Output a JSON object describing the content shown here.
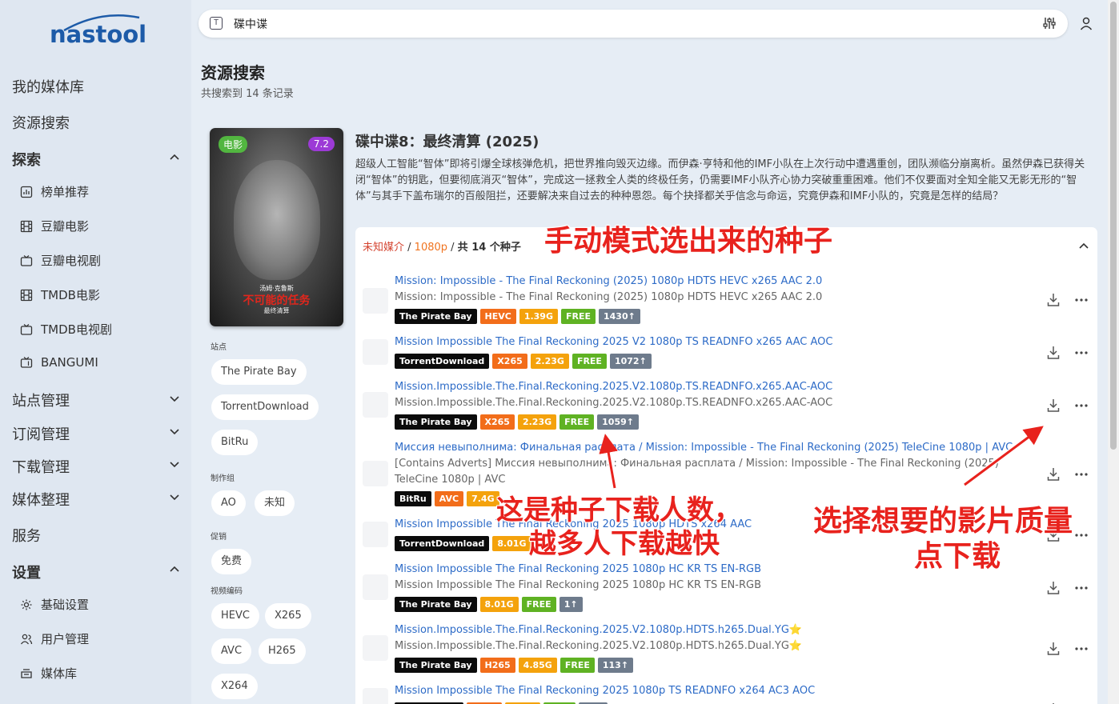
{
  "app": {
    "logo": "nastool"
  },
  "sidebar": {
    "items": [
      {
        "label": "我的媒体库"
      },
      {
        "label": "资源搜索"
      },
      {
        "label": "探索"
      },
      {
        "label": "站点管理"
      },
      {
        "label": "订阅管理"
      },
      {
        "label": "下载管理"
      },
      {
        "label": "媒体整理"
      },
      {
        "label": "服务"
      },
      {
        "label": "设置"
      }
    ],
    "explore_sub": [
      {
        "label": "榜单推荐",
        "icon": "chart-icon"
      },
      {
        "label": "豆瓣电影",
        "icon": "film-icon"
      },
      {
        "label": "豆瓣电视剧",
        "icon": "tv-icon"
      },
      {
        "label": "TMDB电影",
        "icon": "film-icon"
      },
      {
        "label": "TMDB电视剧",
        "icon": "tv-icon"
      },
      {
        "label": "BANGUMI",
        "icon": "tv-icon"
      }
    ],
    "settings_sub": [
      {
        "label": "基础设置",
        "icon": "gear-icon"
      },
      {
        "label": "用户管理",
        "icon": "users-icon"
      },
      {
        "label": "媒体库",
        "icon": "library-icon"
      }
    ]
  },
  "search": {
    "value": "碟中谍"
  },
  "header": {
    "title": "资源搜索",
    "subtitle": "共搜索到 14 条记录"
  },
  "poster": {
    "tag": "电影",
    "rating": "7.2",
    "cap1": "汤姆·克鲁斯",
    "cap2": "不可能的任务",
    "cap3": "最终清算"
  },
  "filters": {
    "site_label": "站点",
    "sites": [
      "The Pirate Bay",
      "TorrentDownload",
      "BitRu"
    ],
    "group_label": "制作组",
    "groups": [
      "AO",
      "未知"
    ],
    "promo_label": "促销",
    "promos": [
      "免费"
    ],
    "codec_label": "视频编码",
    "codecs": [
      "HEVC",
      "X265",
      "AVC",
      "H265",
      "X264"
    ]
  },
  "movie": {
    "title": "碟中谍8：最终清算 (2025)",
    "description": "超级人工智能“智体”即将引爆全球核弹危机，把世界推向毁灭边缘。而伊森·亨特和他的IMF小队在上次行动中遭遇重创，团队濒临分崩离析。虽然伊森已获得关闭“智体”的钥匙，但要彻底消灭“智体”，完成这一拯救全人类的终极任务，仍需要IMF小队齐心协力突破重重困难。他们不仅要面对全知全能又无影无形的“智体”与其手下盖布瑞尔的百般阻拦，还要解决来自过去的种种恩怨。每个抉择都关乎信念与命运，究竟伊森和IMF小队的，究竟是怎样的结局？"
  },
  "group": {
    "media": "未知媒介",
    "sep1": " / ",
    "res": "1080p",
    "sep2": " / ",
    "count": "共 14 个种子"
  },
  "torrents": [
    {
      "title": "Mission: Impossible - The Final Reckoning (2025) 1080p HDTS HEVC x265 AAC 2.0",
      "subtitle": "Mission: Impossible - The Final Reckoning (2025) 1080p HDTS HEVC x265 AAC 2.0",
      "site": "The Pirate Bay",
      "codec": "HEVC",
      "size": "1.39G",
      "promo": "FREE",
      "seeders": "1430↑"
    },
    {
      "title": "Mission Impossible The Final Reckoning 2025 V2 1080p TS READNFO x265 AAC AOC",
      "subtitle": "",
      "site": "TorrentDownload",
      "codec": "X265",
      "size": "2.23G",
      "promo": "FREE",
      "seeders": "1072↑"
    },
    {
      "title": "Mission.Impossible.The.Final.Reckoning.2025.V2.1080p.TS.READNFO.x265.AAC-AOC",
      "subtitle": "Mission.Impossible.The.Final.Reckoning.2025.V2.1080p.TS.READNFO.x265.AAC-AOC",
      "site": "The Pirate Bay",
      "codec": "X265",
      "size": "2.23G",
      "promo": "FREE",
      "seeders": "1059↑"
    },
    {
      "title": "Миссия невыполнима: Финальная расплата / Mission: Impossible - The Final Reckoning (2025) TeleCine 1080p | AVC",
      "subtitle": "[Contains Adverts] Миссия невыполнима: Финальная расплата / Mission: Impossible - The Final Reckoning (2025) TeleCine 1080p | AVC",
      "site": "BitRu",
      "codec": "AVC",
      "size": "7.4G",
      "promo": "",
      "seeders": ""
    },
    {
      "title": "Mission Impossible The Final Reckoning 2025 1080p HDTS x264 AAC",
      "subtitle": "",
      "site": "TorrentDownload",
      "codec": "",
      "size": "8.01G",
      "promo": "",
      "seeders": ""
    },
    {
      "title": "Mission Impossible The Final Reckoning 2025 1080p HC KR TS EN-RGB",
      "subtitle": "Mission Impossible The Final Reckoning 2025 1080p HC KR TS EN-RGB",
      "site": "The Pirate Bay",
      "codec": "",
      "size": "8.01G",
      "promo": "FREE",
      "seeders": "1↑"
    },
    {
      "title": "Mission.Impossible.The.Final.Reckoning.2025.V2.1080p.HDTS.h265.Dual.YG⭐",
      "subtitle": "Mission.Impossible.The.Final.Reckoning.2025.V2.1080p.HDTS.h265.Dual.YG⭐",
      "site": "The Pirate Bay",
      "codec": "H265",
      "size": "4.85G",
      "promo": "FREE",
      "seeders": "113↑"
    },
    {
      "title": "Mission Impossible The Final Reckoning 2025 1080p TS READNFO x264 AC3 AOC",
      "subtitle": "",
      "site": "",
      "codec": "",
      "size": "",
      "promo": "",
      "seeders": ""
    }
  ],
  "annotations": {
    "a1": "手动模式选出来的种子",
    "a2_line1": "这是种子下载人数，",
    "a2_line2": "越多人下载越快",
    "a3_line1": "选择想要的影片质量",
    "a3_line2": "点下载"
  },
  "colors": {
    "accent": "#1d5ba8",
    "link": "#2d6bc7",
    "annotation": "#e8221d"
  }
}
